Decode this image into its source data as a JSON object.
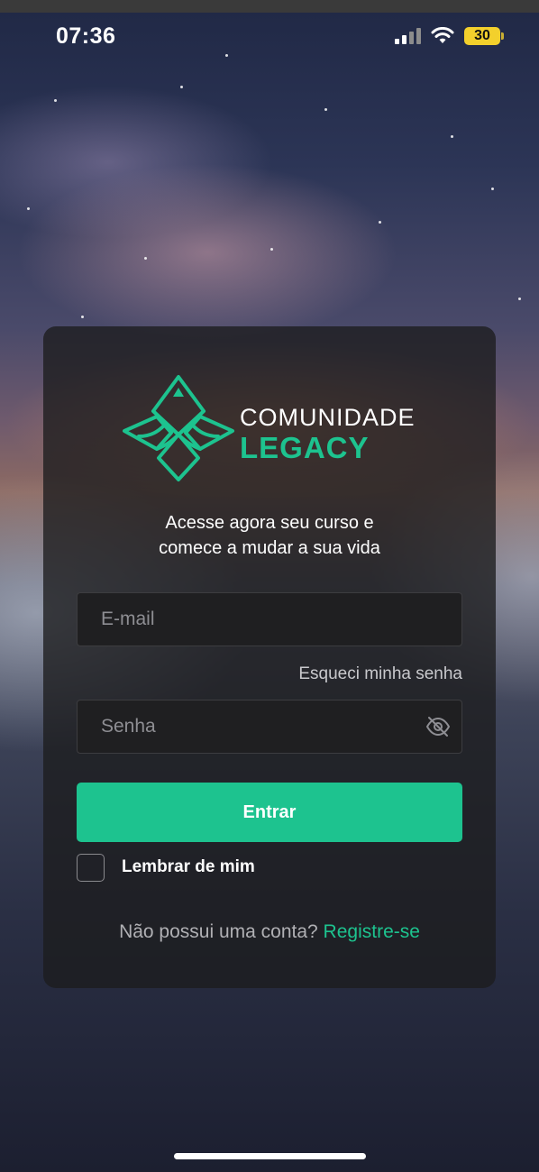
{
  "status_bar": {
    "time": "07:36",
    "battery_level": "30",
    "icons": [
      "cellular-signal-icon",
      "wifi-icon",
      "battery-icon"
    ]
  },
  "brand": {
    "line1": "COMUNIDADE",
    "line2": "LEGACY",
    "accent_color": "#1dc38f"
  },
  "login": {
    "tagline_line1": "Acesse agora seu curso e",
    "tagline_line2": "comece a mudar a sua vida",
    "email_placeholder": "E-mail",
    "forgot_password": "Esqueci minha senha",
    "password_placeholder": "Senha",
    "password_toggle_icon": "eye-off-icon",
    "submit_label": "Entrar",
    "remember_label": "Lembrar de mim",
    "signup_prompt": "Não possui uma conta?",
    "signup_link": "Registre-se"
  }
}
